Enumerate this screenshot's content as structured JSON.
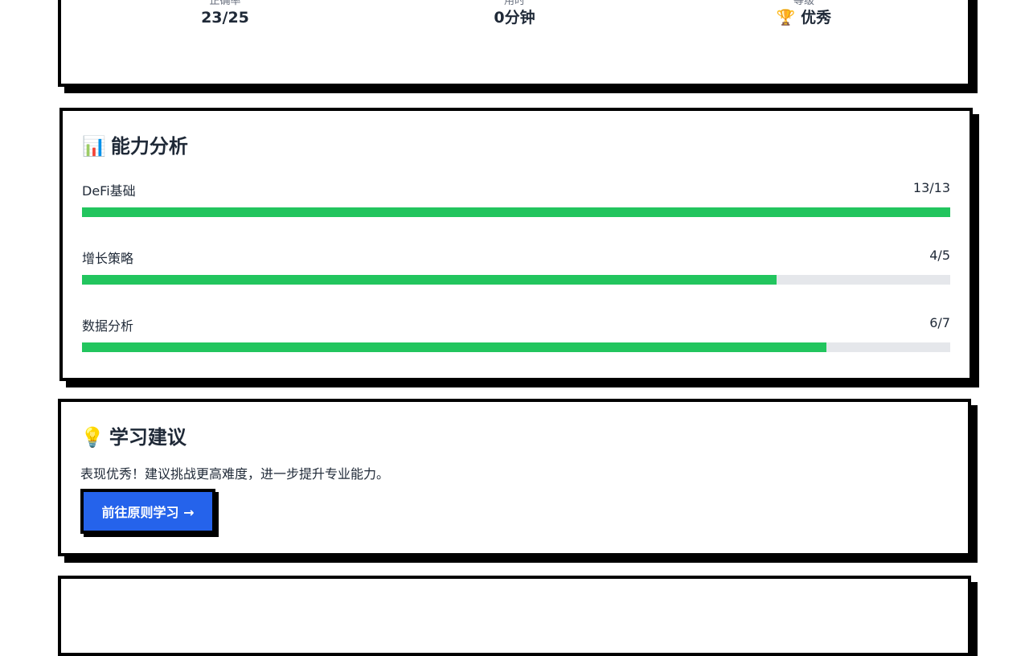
{
  "stats": {
    "accuracy": {
      "label": "正确率",
      "value": "23/25"
    },
    "time": {
      "label": "用时",
      "value": "0分钟"
    },
    "grade": {
      "label": "等级",
      "value": "🏆 优秀"
    }
  },
  "ability": {
    "title_emoji": "📊",
    "title": "能力分析",
    "skills": [
      {
        "name": "DeFi基础",
        "score": "13/13",
        "progress": 1.0
      },
      {
        "name": "增长策略",
        "score": "4/5",
        "progress": 0.8
      },
      {
        "name": "数据分析",
        "score": "6/7",
        "progress": 0.857
      }
    ]
  },
  "advice": {
    "title_emoji": "💡",
    "title": "学习建议",
    "text": "表现优秀！建议挑战更高难度，进一步提升专业能力。",
    "button_label": "前往原则学习 →"
  },
  "colors": {
    "accent": "#2563eb",
    "progress": "#22c55e",
    "track": "#e5e7eb",
    "border": "#000000"
  }
}
